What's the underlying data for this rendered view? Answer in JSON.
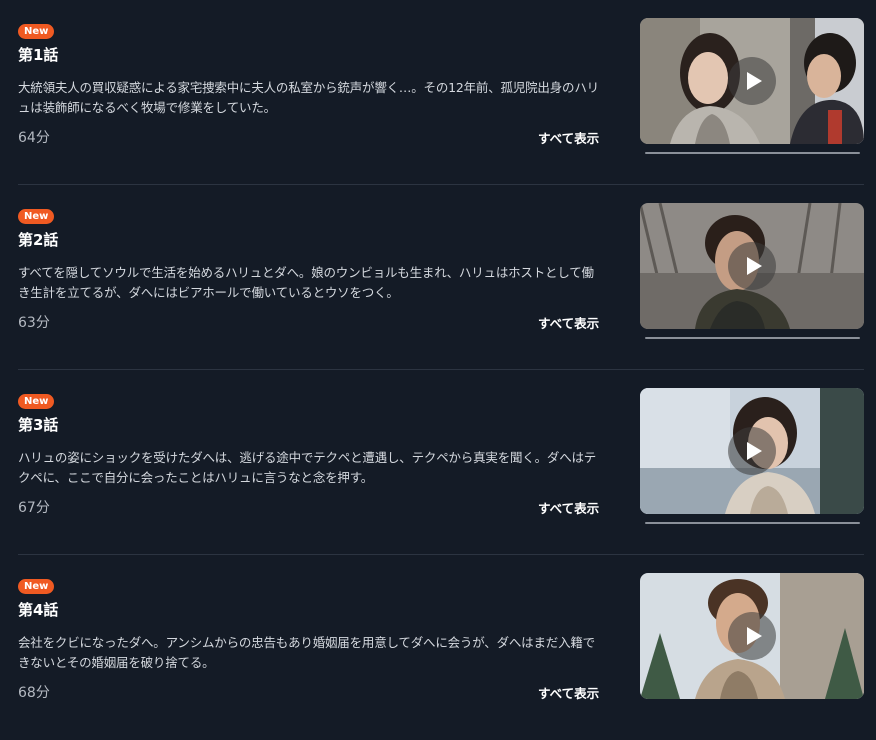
{
  "episodes": [
    {
      "badge": "New",
      "title": "第1話",
      "synopsis": "大統領夫人の買収疑惑による家宅捜索中に夫人の私室から銃声が響く…。その12年前、孤児院出身のハリュは装飾師になるべく牧場で修業をしていた。",
      "duration": "64分",
      "show_all": "すべて表示",
      "progress": 0
    },
    {
      "badge": "New",
      "title": "第2話",
      "synopsis": "すべてを隠してソウルで生活を始めるハリュとダへ。娘のウンビョルも生まれ、ハリュはホストとして働き生計を立てるが、ダへにはビアホールで働いているとウソをつく。",
      "duration": "63分",
      "show_all": "すべて表示",
      "progress": 0
    },
    {
      "badge": "New",
      "title": "第3話",
      "synopsis": "ハリュの姿にショックを受けたダへは、逃げる途中でテクペと遭遇し、テクペから真実を聞く。ダへはテクペに、ここで自分に会ったことはハリュに言うなと念を押す。",
      "duration": "67分",
      "show_all": "すべて表示",
      "progress": 0
    },
    {
      "badge": "New",
      "title": "第4話",
      "synopsis": "会社をクビになったダへ。アンシムからの忠告もあり婚姻届を用意してダへに会うが、ダへはまだ入籍できないとその婚姻届を破り捨てる。",
      "duration": "68分",
      "show_all": "すべて表示",
      "progress": 0
    }
  ],
  "icons": {
    "play": "play-icon"
  },
  "colors": {
    "background": "#141b26",
    "badge": "#f05a22",
    "divider": "#2c3441",
    "text_secondary": "#b4b9c1"
  }
}
